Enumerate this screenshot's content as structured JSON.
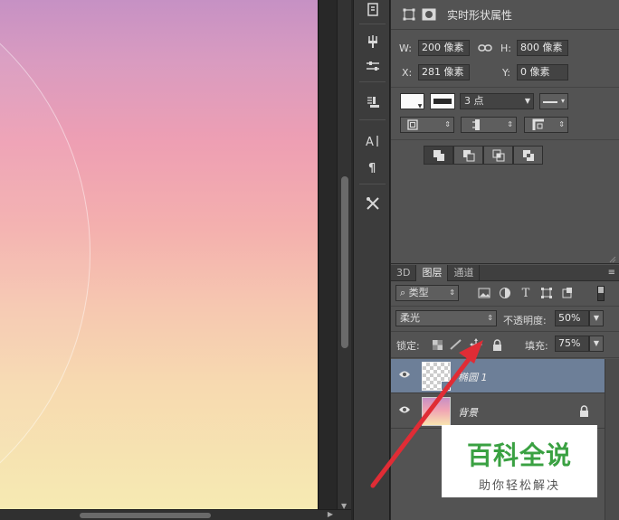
{
  "properties_panel": {
    "title": "实时形状属性",
    "w_label": "W:",
    "w_value": "200 像素",
    "h_label": "H:",
    "h_value": "800 像素",
    "x_label": "X:",
    "x_value": "281 像素",
    "y_label": "Y:",
    "y_value": "0 像素",
    "stroke_width": "3 点"
  },
  "layers_panel": {
    "tabs": [
      "3D",
      "图层",
      "通道"
    ],
    "active_tab": "图层",
    "filter_type": "类型",
    "blend_mode": "柔光",
    "opacity_label": "不透明度:",
    "opacity_value": "50%",
    "lock_label": "锁定:",
    "fill_label": "填充:",
    "fill_value": "75%",
    "layers": [
      {
        "name": "椭圆 1",
        "selected": true
      },
      {
        "name": "背景",
        "selected": false
      }
    ]
  },
  "watermark": {
    "title": "百科全说",
    "subtitle": "助你轻松解决"
  },
  "colors": {
    "panel": "#535353",
    "selected_layer": "#6d7f98",
    "annotation_arrow": "#e02c35",
    "watermark_green": "#3aa142"
  }
}
